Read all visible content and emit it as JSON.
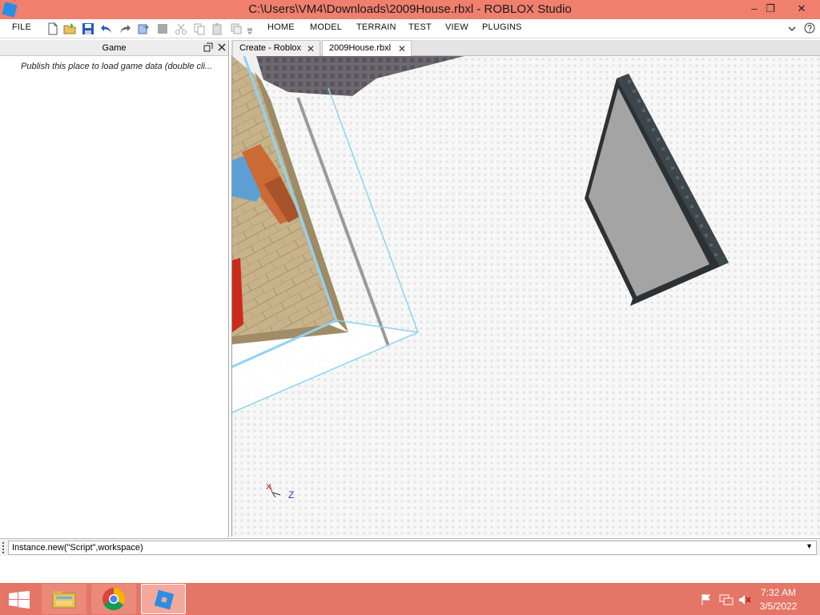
{
  "window": {
    "title": "C:\\Users\\VM4\\Downloads\\2009House.rbxl - ROBLOX Studio",
    "minimize": "–",
    "restore": "❐",
    "close": "✕"
  },
  "menubar": {
    "items": [
      "FILE",
      "HOME",
      "MODEL",
      "TERRAIN",
      "TEST",
      "VIEW",
      "PLUGINS"
    ],
    "quick_tools": [
      "new-file-icon",
      "open-file-icon",
      "save-icon",
      "undo-icon",
      "redo-icon",
      "import-icon",
      "stop-icon",
      "cut-icon",
      "copy-icon",
      "paste-icon",
      "duplicate-icon",
      "customize-icon"
    ],
    "right_icons": [
      "expand-ribbon-icon",
      "help-icon"
    ]
  },
  "game_panel": {
    "title": "Game",
    "message": "Publish this place to load game data (double cli..."
  },
  "tabs": [
    {
      "label": "Create - Roblox",
      "active": false
    },
    {
      "label": "2009House.rbxl",
      "active": true
    }
  ],
  "viewport": {
    "axis_x": "X",
    "axis_z": "Z"
  },
  "command_bar": {
    "value": "Instance.new(\"Script\",workspace)"
  },
  "taskbar": {
    "apps": [
      "file-explorer-icon",
      "chrome-icon",
      "roblox-studio-icon"
    ],
    "time": "7:32 AM",
    "date": "3/5/2022"
  },
  "colors": {
    "titlebar": "#f07f6e",
    "taskbar": "#e57566",
    "selection": "#8fd3f4"
  }
}
